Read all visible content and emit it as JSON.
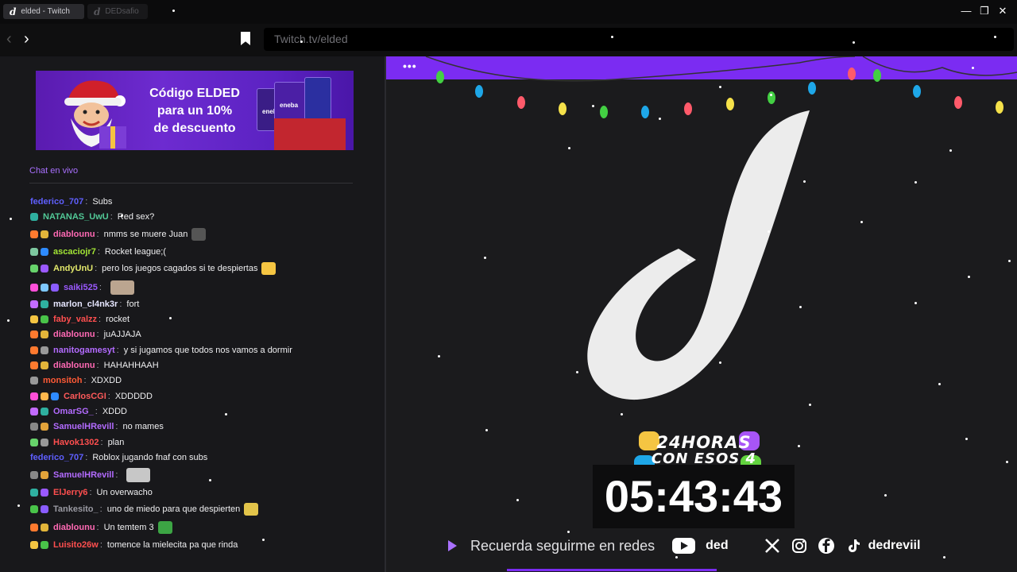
{
  "tabs": [
    {
      "label": "elded - Twitch",
      "active": true
    },
    {
      "label": "DEDsafio",
      "active": false
    }
  ],
  "window_controls": {
    "minimize": "—",
    "restore": "❐",
    "close": "✕"
  },
  "nav": {
    "back": "‹",
    "forward": "›",
    "url": "Twitch.tv/elded"
  },
  "banner": {
    "line1": "Código ELDED",
    "line2": "para un 10%",
    "line3": "de descuento",
    "card_label": "eneba"
  },
  "chat_label": "Chat en vivo",
  "colors": {
    "accent": "#7b2cf2",
    "twitch_purple": "#a970ff"
  },
  "chat": [
    {
      "user": "federico_707",
      "text": "Subs",
      "color": "#5f5fff",
      "badges": []
    },
    {
      "user": "NATANAS_UwU",
      "text": "Red sex?",
      "color": "#52c997",
      "badges": [
        "#2fb0a0"
      ]
    },
    {
      "user": "diablounu",
      "text": "nmms se muere Juan",
      "color": "#ff69b4",
      "badges": [
        "#ff7a2f",
        "#e2b53a"
      ],
      "emote": "#555"
    },
    {
      "user": "ascaciojr7",
      "text": "Rocket league;(",
      "color": "#a3e635",
      "badges": [
        "#7ec8a0",
        "#2e8bff"
      ]
    },
    {
      "user": "AndyUnU",
      "text": "pero los juegos cagados si te despiertas",
      "color": "#e2e86b",
      "badges": [
        "#67d36b",
        "#9b59ff"
      ],
      "emote": "#f5c542"
    },
    {
      "user": "saiki525",
      "text": "",
      "color": "#9b59ff",
      "badges": [
        "#ff4fd8",
        "#7ec8ff",
        "#8a5cff"
      ],
      "emote": "#bba590"
    },
    {
      "user": "marlon_cl4nk3r",
      "text": "fort",
      "color": "#e6e6ff",
      "badges": [
        "#c36bff",
        "#2fb0a0"
      ]
    },
    {
      "user": "faby_valzz",
      "text": "rocket",
      "color": "#ff4f4f",
      "badges": [
        "#f5c542",
        "#49c349"
      ]
    },
    {
      "user": "diablounu",
      "text": "juAJJAJA",
      "color": "#ff69b4",
      "badges": [
        "#ff7a2f",
        "#e2b53a"
      ]
    },
    {
      "user": "nanitogamesyt",
      "text": "y si jugamos que todos nos vamos a dormir",
      "color": "#b36bff",
      "badges": [
        "#ff7a2f",
        "#999"
      ]
    },
    {
      "user": "diablounu",
      "text": "HAHAHHAAH",
      "color": "#ff69b4",
      "badges": [
        "#ff7a2f",
        "#e2b53a"
      ]
    },
    {
      "user": "monsitoh",
      "text": "XDXDD",
      "color": "#ff5a36",
      "badges": [
        "#999"
      ]
    },
    {
      "user": "CarlosCGI",
      "text": "XDDDDD",
      "color": "#ff5a5a",
      "badges": [
        "#ff4fd8",
        "#ffb84d",
        "#2e8bff"
      ]
    },
    {
      "user": "OmarSG_",
      "text": "XDDD",
      "color": "#b36bff",
      "badges": [
        "#c36bff",
        "#2fb0a0"
      ]
    },
    {
      "user": "SamuelHRevill",
      "text": "no mames",
      "color": "#b36bff",
      "badges": [
        "#888",
        "#e2a33a"
      ]
    },
    {
      "user": "Havok1302",
      "text": "plan",
      "color": "#ff4f4f",
      "badges": [
        "#67d36b",
        "#999"
      ]
    },
    {
      "user": "federico_707",
      "text": "Roblox jugando fnaf con subs",
      "color": "#5f5fff",
      "badges": []
    },
    {
      "user": "SamuelHRevill",
      "text": "",
      "color": "#b36bff",
      "badges": [
        "#888",
        "#e2a33a"
      ],
      "emote": "#c7c7c7"
    },
    {
      "user": "ElJerry6",
      "text": "Un overwacho",
      "color": "#ff4f4f",
      "badges": [
        "#2fb0a0",
        "#9b59ff"
      ]
    },
    {
      "user": "Tankesito_",
      "text": "uno de miedo para que despierten",
      "color": "#9a9aa3",
      "badges": [
        "#49c349",
        "#8a5cff"
      ],
      "emote": "#e2c44a"
    },
    {
      "user": "diablounu",
      "text": "Un temtem 3",
      "color": "#ff69b4",
      "badges": [
        "#ff7a2f",
        "#e2b53a"
      ],
      "emote": "#3ca544"
    },
    {
      "user": "Luisito26w",
      "text": "tomence la mielecita pa que rinda",
      "color": "#ff4f4f",
      "badges": [
        "#f5c542",
        "#49c349"
      ]
    }
  ],
  "stream": {
    "menu_dots": "•••",
    "title_line1": "24HORAS",
    "title_line2": "CON ESOS 4",
    "timer": "05:43:43",
    "follow_text": "Recuerda seguirme en redes",
    "youtube_handle": "ded",
    "social_handle": "dedreviil",
    "social_icons": [
      "x-icon",
      "instagram-icon",
      "facebook-icon",
      "tiktok-icon"
    ]
  }
}
